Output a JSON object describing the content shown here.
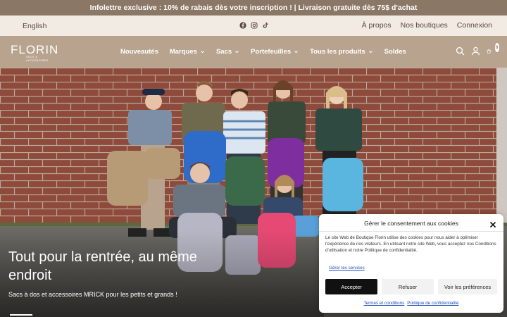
{
  "announcement": "Infolettre exclusive : 10% de rabais dès votre inscription ! | Livraison gratuite dès 75$ d'achat",
  "utility": {
    "language": "English",
    "socials": [
      "facebook-icon",
      "instagram-icon",
      "tiktok-icon"
    ],
    "links": [
      "À propos",
      "Nos boutiques",
      "Connexion"
    ]
  },
  "nav": {
    "logo": "FLORIN",
    "logo_tagline": "SACS & ACCESSOIRES",
    "menu": [
      {
        "label": "Nouveautés",
        "dropdown": false
      },
      {
        "label": "Marques",
        "dropdown": true
      },
      {
        "label": "Sacs",
        "dropdown": true
      },
      {
        "label": "Portefeuilles",
        "dropdown": true
      },
      {
        "label": "Tous les produits",
        "dropdown": true
      },
      {
        "label": "Soldes",
        "dropdown": false
      }
    ],
    "icons": [
      "search-icon",
      "account-icon",
      "cart-icon"
    ],
    "cart_count": "0"
  },
  "hero": {
    "title": "Tout pour la rentrée, au même endroit",
    "subtitle": "Sacs à dos et accessoires MRICK pour les petits et grands !"
  },
  "cookie": {
    "title": "Gérer le consentement aux cookies",
    "body": "Le site Web de Boutique Florin utilise des cookies pour nous aider à optimiser l'expérience de nos visiteurs. En utilisant notre site Web, vous acceptez nos Conditions d'utilisation et notre Politique de confidentialité.",
    "manage": "Gérer les services",
    "accept": "Accepter",
    "refuse": "Refuser",
    "preferences": "Voir les préférences",
    "terms": "Termes et conditions",
    "privacy": "Politique de confidentialité"
  },
  "colors": {
    "announce_bg": "#8a7766",
    "utility_bg": "#f1ebe4",
    "nav_bg": "#b8a48e",
    "brick": "#8e4b3b",
    "button_dark": "#111111"
  }
}
